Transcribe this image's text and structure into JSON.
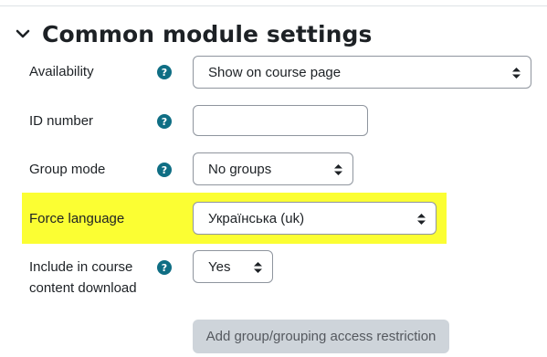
{
  "section": {
    "title": "Common module settings",
    "icon": "chevron-down-icon"
  },
  "fields": {
    "availability": {
      "label": "Availability",
      "value": "Show on course page"
    },
    "id_number": {
      "label": "ID number",
      "value": ""
    },
    "group_mode": {
      "label": "Group mode",
      "value": "No groups"
    },
    "force_language": {
      "label": "Force language",
      "value": "Українська (uk)",
      "highlight_color": "#fbfe33"
    },
    "include_download": {
      "label_line1": "Include in course",
      "label_line2": "content download",
      "value": "Yes"
    }
  },
  "help_icon": {
    "glyph": "?",
    "color": "#0f6e84",
    "icon": "question-circle-icon"
  },
  "buttons": {
    "add_restriction": "Add group/grouping access restriction"
  }
}
